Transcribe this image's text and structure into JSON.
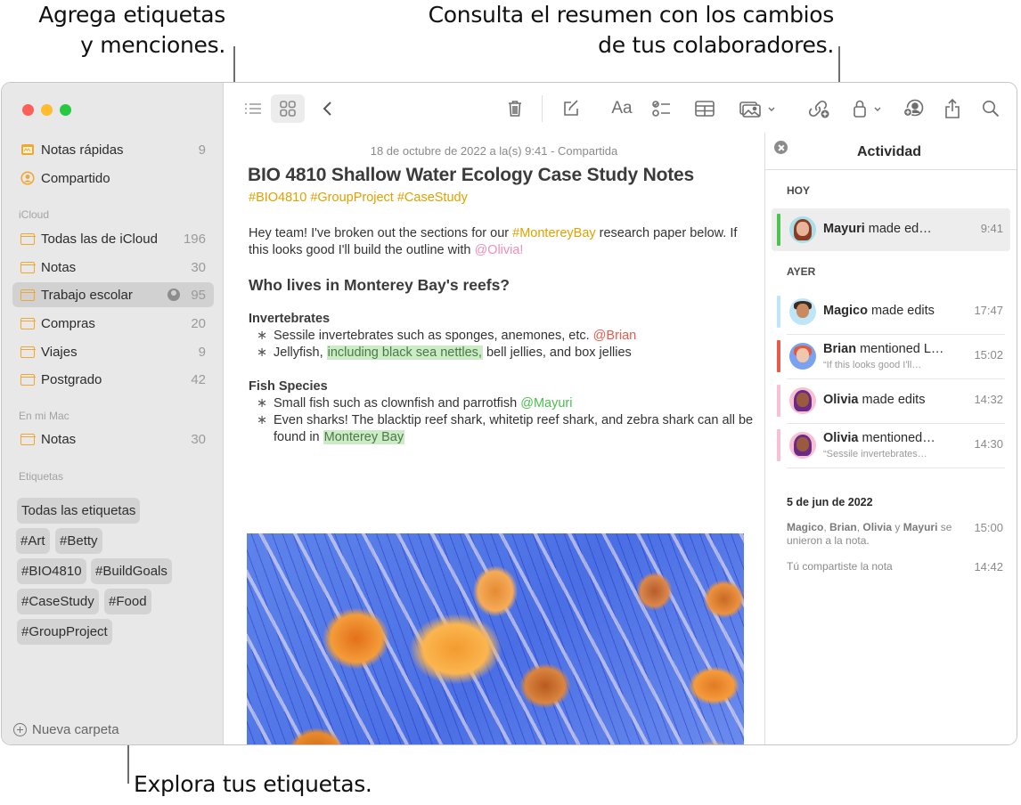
{
  "callouts": {
    "tags_mentions": [
      "Agrega etiquetas",
      "y menciones."
    ],
    "activity_summary": [
      "Consulta el resumen con los cambios",
      "de tus colaboradores."
    ],
    "browse_tags": "Explora tus etiquetas."
  },
  "window_controls": [
    "close",
    "minimize",
    "zoom"
  ],
  "sidebar": {
    "pinned": [
      {
        "label": "Notas rápidas",
        "count": "9",
        "icon": "quick-note-icon"
      },
      {
        "label": "Compartido",
        "count": "",
        "icon": "shared-person-icon"
      }
    ],
    "sections": [
      {
        "title": "iCloud",
        "folders": [
          {
            "label": "Todas las de iCloud",
            "count": "196"
          },
          {
            "label": "Notas",
            "count": "30"
          },
          {
            "label": "Trabajo escolar",
            "count": "95",
            "shared": true,
            "selected": true
          },
          {
            "label": "Compras",
            "count": "20"
          },
          {
            "label": "Viajes",
            "count": "9"
          },
          {
            "label": "Postgrado",
            "count": "42"
          }
        ]
      },
      {
        "title": "En mi Mac",
        "folders": [
          {
            "label": "Notas",
            "count": "30"
          }
        ]
      }
    ],
    "tags_title": "Etiquetas",
    "tags": [
      "Todas las etiquetas",
      "#Art",
      "#Betty",
      "#BIO4810",
      "#BuildGoals",
      "#CaseStudy",
      "#Food",
      "#GroupProject"
    ],
    "new_folder": "Nueva carpeta"
  },
  "toolbar": {
    "buttons": [
      "list-view",
      "gallery-view",
      "back",
      "delete",
      "new-note",
      "format-text",
      "checklist",
      "table",
      "media",
      "collaborate",
      "lock",
      "share-people",
      "share",
      "search"
    ],
    "format_label": "Aa"
  },
  "note": {
    "date": "18 de octubre de 2022 a la(s) 9:41 - Compartida",
    "title": "BIO 4810 Shallow Water Ecology Case Study Notes",
    "tags": "#BIO4810 #GroupProject #CaseStudy",
    "intro": {
      "part1": "Hey team! I've broken out the sections for our ",
      "hashtag": "#MontereyBay",
      "part2": " research paper below. If this looks good I'll build the outline with ",
      "mention": "@Olivia!"
    },
    "heading": "Who lives in Monterey Bay's reefs?",
    "sections": [
      {
        "title": "Invertebrates",
        "bullets": [
          {
            "text": "Sessile invertebrates such as sponges, anemones, etc. ",
            "mention": "@Brian"
          },
          {
            "before": "Jellyfish, ",
            "highlight": "including black sea nettles,",
            "after": " bell jellies, and box jellies"
          }
        ]
      },
      {
        "title": "Fish Species",
        "bullets": [
          {
            "text": "Small fish such as clownfish and parrotfish ",
            "mention": "@Mayuri"
          },
          {
            "before": "Even sharks! The blacktip reef shark, whitetip reef shark, and zebra shark can all be found in ",
            "highlight": "Monterey Bay",
            "after": ""
          }
        ]
      }
    ],
    "bullet_glyph": "∗",
    "image_alt": "jellyfish-photo"
  },
  "activity": {
    "title": "Actividad",
    "today_label": "HOY",
    "yesterday_label": "AYER",
    "today": [
      {
        "name": "Mayuri",
        "action": " made ed…",
        "time": "9:41",
        "color": "#4bc44f"
      }
    ],
    "yesterday": [
      {
        "name": "Magico",
        "action": " made edits",
        "time": "17:47",
        "color": "#bfe6f7"
      },
      {
        "name": "Brian",
        "action": " mentioned L…",
        "sub": "“If this looks good I'll…",
        "time": "15:02",
        "color": "#ea5a4a"
      },
      {
        "name": "Olivia",
        "action": " made edits",
        "time": "14:32",
        "color": "#f7c1d3"
      },
      {
        "name": "Olivia",
        "action": " mentioned…",
        "sub": "“Sessile invertebrates…",
        "time": "14:30",
        "color": "#f7c1d3"
      }
    ],
    "older_date": "5 de jun de 2022",
    "joined": {
      "names": [
        "Magico",
        "Brian",
        "Olivia"
      ],
      "and": " y ",
      "last": "Mayuri",
      "suffix": " se unieron a la nota.",
      "time": "15:00"
    },
    "shared": {
      "text": "Tú compartiste la nota",
      "time": "14:42"
    }
  }
}
